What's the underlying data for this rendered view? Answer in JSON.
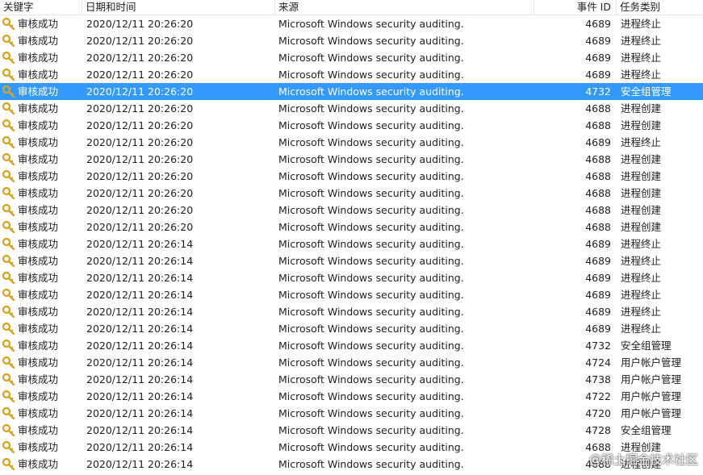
{
  "columns": {
    "keyword": "关键字",
    "datetime": "日期和时间",
    "source": "来源",
    "event_id": "事件 ID",
    "task_category": "任务类别"
  },
  "rows": [
    {
      "keyword": "审核成功",
      "datetime": "2020/12/11 20:26:20",
      "source": "Microsoft Windows security auditing.",
      "event_id": "4689",
      "task_category": "进程终止",
      "selected": false
    },
    {
      "keyword": "审核成功",
      "datetime": "2020/12/11 20:26:20",
      "source": "Microsoft Windows security auditing.",
      "event_id": "4689",
      "task_category": "进程终止",
      "selected": false
    },
    {
      "keyword": "审核成功",
      "datetime": "2020/12/11 20:26:20",
      "source": "Microsoft Windows security auditing.",
      "event_id": "4689",
      "task_category": "进程终止",
      "selected": false
    },
    {
      "keyword": "审核成功",
      "datetime": "2020/12/11 20:26:20",
      "source": "Microsoft Windows security auditing.",
      "event_id": "4689",
      "task_category": "进程终止",
      "selected": false
    },
    {
      "keyword": "审核成功",
      "datetime": "2020/12/11 20:26:20",
      "source": "Microsoft Windows security auditing.",
      "event_id": "4732",
      "task_category": "安全组管理",
      "selected": true
    },
    {
      "keyword": "审核成功",
      "datetime": "2020/12/11 20:26:20",
      "source": "Microsoft Windows security auditing.",
      "event_id": "4688",
      "task_category": "进程创建",
      "selected": false
    },
    {
      "keyword": "审核成功",
      "datetime": "2020/12/11 20:26:20",
      "source": "Microsoft Windows security auditing.",
      "event_id": "4688",
      "task_category": "进程创建",
      "selected": false
    },
    {
      "keyword": "审核成功",
      "datetime": "2020/12/11 20:26:20",
      "source": "Microsoft Windows security auditing.",
      "event_id": "4689",
      "task_category": "进程终止",
      "selected": false
    },
    {
      "keyword": "审核成功",
      "datetime": "2020/12/11 20:26:20",
      "source": "Microsoft Windows security auditing.",
      "event_id": "4688",
      "task_category": "进程创建",
      "selected": false
    },
    {
      "keyword": "审核成功",
      "datetime": "2020/12/11 20:26:20",
      "source": "Microsoft Windows security auditing.",
      "event_id": "4688",
      "task_category": "进程创建",
      "selected": false
    },
    {
      "keyword": "审核成功",
      "datetime": "2020/12/11 20:26:20",
      "source": "Microsoft Windows security auditing.",
      "event_id": "4688",
      "task_category": "进程创建",
      "selected": false
    },
    {
      "keyword": "审核成功",
      "datetime": "2020/12/11 20:26:20",
      "source": "Microsoft Windows security auditing.",
      "event_id": "4688",
      "task_category": "进程创建",
      "selected": false
    },
    {
      "keyword": "审核成功",
      "datetime": "2020/12/11 20:26:20",
      "source": "Microsoft Windows security auditing.",
      "event_id": "4688",
      "task_category": "进程创建",
      "selected": false
    },
    {
      "keyword": "审核成功",
      "datetime": "2020/12/11 20:26:14",
      "source": "Microsoft Windows security auditing.",
      "event_id": "4689",
      "task_category": "进程终止",
      "selected": false
    },
    {
      "keyword": "审核成功",
      "datetime": "2020/12/11 20:26:14",
      "source": "Microsoft Windows security auditing.",
      "event_id": "4689",
      "task_category": "进程终止",
      "selected": false
    },
    {
      "keyword": "审核成功",
      "datetime": "2020/12/11 20:26:14",
      "source": "Microsoft Windows security auditing.",
      "event_id": "4689",
      "task_category": "进程终止",
      "selected": false
    },
    {
      "keyword": "审核成功",
      "datetime": "2020/12/11 20:26:14",
      "source": "Microsoft Windows security auditing.",
      "event_id": "4689",
      "task_category": "进程终止",
      "selected": false
    },
    {
      "keyword": "审核成功",
      "datetime": "2020/12/11 20:26:14",
      "source": "Microsoft Windows security auditing.",
      "event_id": "4689",
      "task_category": "进程终止",
      "selected": false
    },
    {
      "keyword": "审核成功",
      "datetime": "2020/12/11 20:26:14",
      "source": "Microsoft Windows security auditing.",
      "event_id": "4689",
      "task_category": "进程终止",
      "selected": false
    },
    {
      "keyword": "审核成功",
      "datetime": "2020/12/11 20:26:14",
      "source": "Microsoft Windows security auditing.",
      "event_id": "4732",
      "task_category": "安全组管理",
      "selected": false
    },
    {
      "keyword": "审核成功",
      "datetime": "2020/12/11 20:26:14",
      "source": "Microsoft Windows security auditing.",
      "event_id": "4724",
      "task_category": "用户帐户管理",
      "selected": false
    },
    {
      "keyword": "审核成功",
      "datetime": "2020/12/11 20:26:14",
      "source": "Microsoft Windows security auditing.",
      "event_id": "4738",
      "task_category": "用户帐户管理",
      "selected": false
    },
    {
      "keyword": "审核成功",
      "datetime": "2020/12/11 20:26:14",
      "source": "Microsoft Windows security auditing.",
      "event_id": "4722",
      "task_category": "用户帐户管理",
      "selected": false
    },
    {
      "keyword": "审核成功",
      "datetime": "2020/12/11 20:26:14",
      "source": "Microsoft Windows security auditing.",
      "event_id": "4720",
      "task_category": "用户帐户管理",
      "selected": false
    },
    {
      "keyword": "审核成功",
      "datetime": "2020/12/11 20:26:14",
      "source": "Microsoft Windows security auditing.",
      "event_id": "4728",
      "task_category": "安全组管理",
      "selected": false
    },
    {
      "keyword": "审核成功",
      "datetime": "2020/12/11 20:26:14",
      "source": "Microsoft Windows security auditing.",
      "event_id": "4688",
      "task_category": "进程创建",
      "selected": false
    },
    {
      "keyword": "审核成功",
      "datetime": "2020/12/11 20:26:14",
      "source": "Microsoft Windows security auditing.",
      "event_id": "4688",
      "task_category": "进程创建",
      "selected": false
    }
  ],
  "row_icon": "key-icon",
  "colors": {
    "selection": "#3399ff",
    "key_gold": "#d8a21a"
  },
  "watermark": "@稀土掘金技术社区"
}
